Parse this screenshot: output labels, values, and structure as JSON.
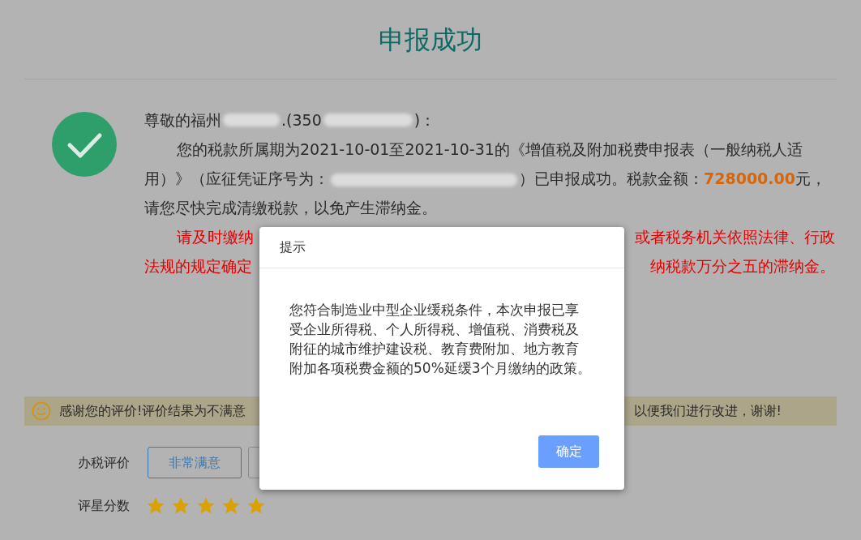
{
  "title": "申报成功",
  "greeting": {
    "prefix": "尊敬的福州",
    "middle": ".(350",
    "suffix": ")："
  },
  "notice": {
    "before": "您的税款所属期为2021-10-01至2021-10-31的《增值税及附加税费申报表（一般纳税人适用）》（应征凭证序号为：",
    "after": "）已申报成功。税款金额：",
    "amount": "728000.00",
    "end": "元，请您尽快完成清缴税款，以免产生滞纳金。"
  },
  "warning": [
    {
      "left": "请及时缴纳",
      "right": "或者税务机关依照法律、行政"
    },
    {
      "left": "法规的规定确定",
      "right": "纳税款万分之五的滞纳金。"
    }
  ],
  "feedback": {
    "left": "感谢您的评价!评价结果为不满意",
    "right": "以便我们进行改进，谢谢!"
  },
  "rating": {
    "label": "办税评价",
    "options": [
      {
        "label": "非常满意",
        "selected": true
      },
      {
        "selected": false
      }
    ]
  },
  "score": {
    "label": "评星分数",
    "stars": 5
  },
  "dialog": {
    "title": "提示",
    "message": "您符合制造业中型企业缓税条件，本次申报已享受企业所得税、个人所得税、增值税、消费税及附征的城市维护建设税、教育费附加、地方教育附加各项税费金额的50%延缓3个月缴纳的政策。",
    "button": "确定"
  }
}
